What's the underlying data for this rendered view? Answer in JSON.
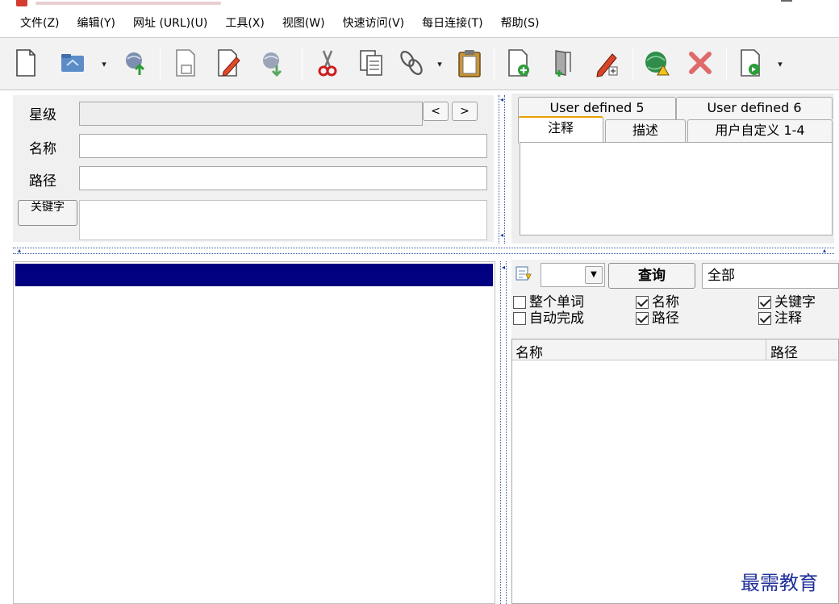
{
  "menu": [
    "文件(Z)",
    "编辑(Y)",
    "网址 (URL)(U)",
    "工具(X)",
    "视图(W)",
    "快速访问(V)",
    "每日连接(T)",
    "帮助(S)"
  ],
  "toolbar": {
    "icons": [
      "new-document-icon",
      "open-folder-icon",
      "upload-globe-icon",
      "save-icon",
      "edit-document-icon",
      "download-globe-icon",
      "cut-icon",
      "copy-icon",
      "link-icon",
      "paste-icon",
      "add-document-icon",
      "add-folder-icon",
      "edit-pencil-icon",
      "check-globe-icon",
      "delete-icon",
      "export-icon"
    ]
  },
  "form": {
    "rating_label": "星级",
    "name_label": "名称",
    "path_label": "路径",
    "keywords_button": "关键字",
    "prev_label": "<",
    "next_label": ">",
    "name_value": "",
    "path_value": ""
  },
  "tabs": {
    "row1": [
      "User defined 5",
      "User defined 6"
    ],
    "row2": [
      "注释",
      "描述",
      "用户自定义 1-4"
    ]
  },
  "search": {
    "query_button": "查询",
    "scope_value": "全部",
    "options": [
      {
        "label": "整个单词",
        "checked": false
      },
      {
        "label": "名称",
        "checked": true
      },
      {
        "label": "关键字",
        "checked": true
      },
      {
        "label": "自动完成",
        "checked": false
      },
      {
        "label": "路径",
        "checked": true
      },
      {
        "label": "注释",
        "checked": true
      }
    ],
    "columns": [
      "名称",
      "路径"
    ]
  },
  "watermark": "最需教育",
  "colors": {
    "list_header": "#000080",
    "splitter": "#3858a8",
    "active_tab": "#e8a000"
  }
}
